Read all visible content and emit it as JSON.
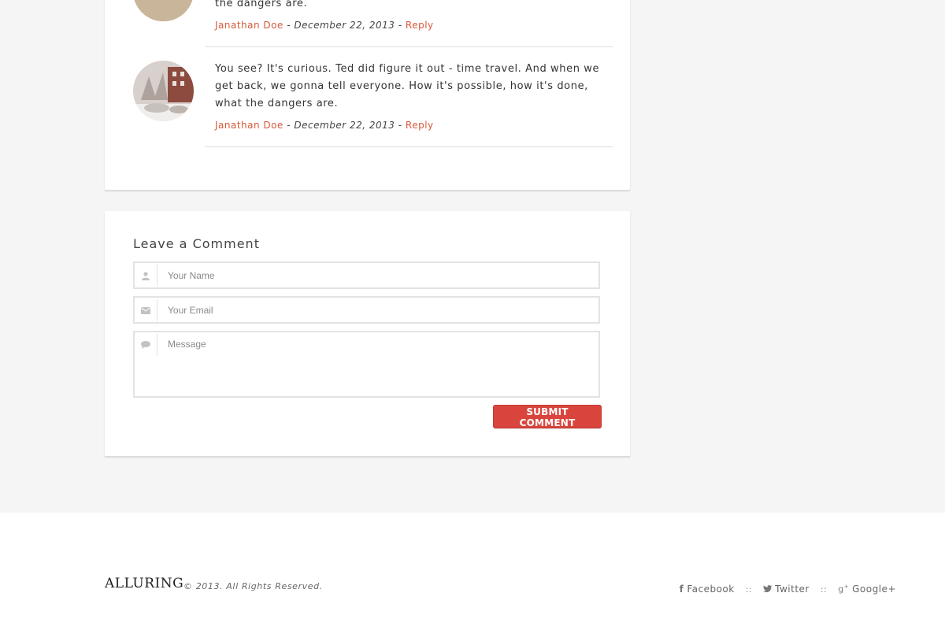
{
  "comments": [
    {
      "text": "the dangers are.",
      "author": "Janathan Doe",
      "date": "December 22, 2013",
      "reply": "Reply"
    },
    {
      "text": "You see? It's curious. Ted did figure it out - time travel. And when we get back, we gonna tell everyone. How it's possible, how it's done, what the dangers are.",
      "author": "Janathan Doe",
      "date": "December 22, 2013",
      "reply": "Reply"
    }
  ],
  "meta_sep": "-",
  "form": {
    "title": "Leave a Comment",
    "name_placeholder": "Your Name",
    "email_placeholder": "Your Email",
    "message_placeholder": "Message",
    "submit_label": "SUBMIT COMMENT"
  },
  "footer": {
    "logo": "ALLURING",
    "copyright": "© 2013. All Rights Reserved.",
    "links": [
      {
        "label": "Facebook",
        "icon": "facebook-icon"
      },
      {
        "label": "Twitter",
        "icon": "twitter-icon"
      },
      {
        "label": "Google+",
        "icon": "google-plus-icon"
      }
    ],
    "separator": "::"
  },
  "colors": {
    "accent": "#d9583b",
    "button": "#d9453d",
    "page_bg": "#f5f5f5"
  }
}
